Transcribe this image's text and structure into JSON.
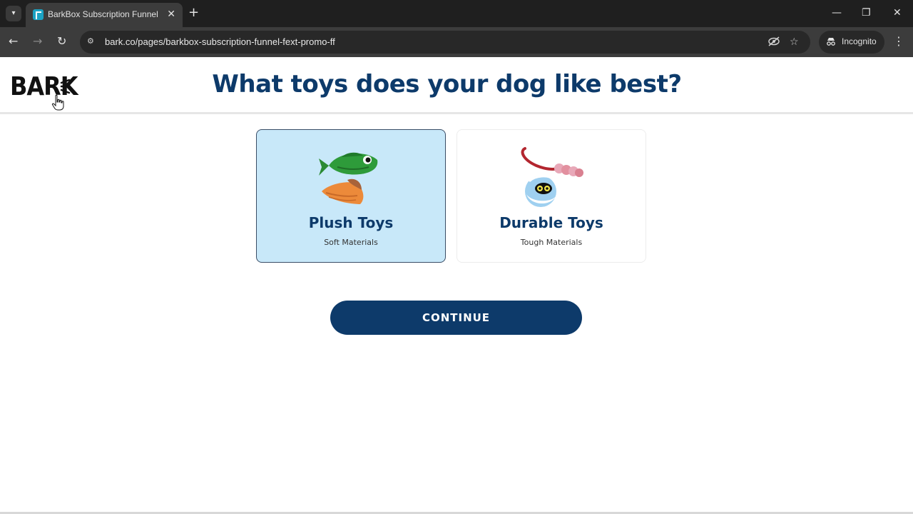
{
  "browser": {
    "tab_title": "BarkBox Subscription Funnel - l",
    "tab_close": "✕",
    "new_tab": "+",
    "url": "bark.co/pages/barkbox-subscription-funnel-fext-promo-ff",
    "incognito_label": "Incognito",
    "icons": [
      "tab-search-icon",
      "bark-favicon-icon",
      "back-arrow-icon",
      "forward-arrow-icon",
      "reload-icon",
      "site-info-icon",
      "eye-off-icon",
      "star-icon",
      "incognito-icon",
      "more-vert-icon",
      "minimize-icon",
      "restore-icon",
      "close-icon"
    ]
  },
  "header": {
    "logo_text": "BARK",
    "question": "What toys does your dog like best?"
  },
  "options": [
    {
      "title": "Plush Toys",
      "subtitle": "Soft Materials",
      "selected": true
    },
    {
      "title": "Durable Toys",
      "subtitle": "Tough Materials",
      "selected": false
    }
  ],
  "continue_label": "CONTINUE",
  "colors": {
    "brand_navy": "#0d3a6a",
    "selected_bg": "#c8e8f9",
    "chrome_dark": "#1f1f1f",
    "chrome_toolbar": "#3c3c3c"
  }
}
